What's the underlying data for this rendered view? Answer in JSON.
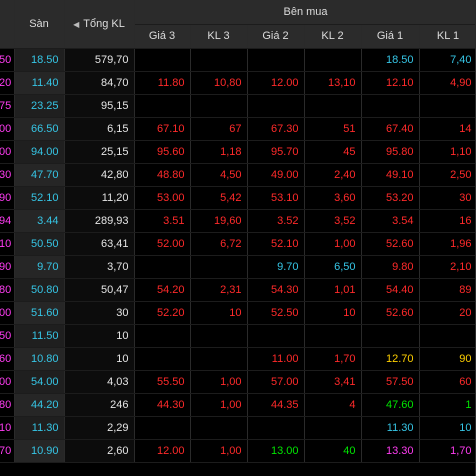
{
  "header": {
    "ref_label": "",
    "floor_label": "Sàn",
    "total_volume_label": "Tổng KL",
    "sort_icon": "triangle-left-icon",
    "buy_side_label": "Bên mua",
    "sub": [
      "Giá 3",
      "KL 3",
      "Giá 2",
      "KL 2",
      "Giá 1",
      "KL 1"
    ]
  },
  "colors": {
    "red": "#ff2a2a",
    "green": "#00e600",
    "cyan": "#36c6e6",
    "yellow": "#ffd000",
    "purple": "#ff3cf2"
  },
  "rows": [
    {
      "ref": "50",
      "floor": "18.50",
      "total": "579,70",
      "p3": "",
      "v3": "",
      "p2": "",
      "v2": "",
      "p1": "18.50",
      "v1": "7,40",
      "c3": "wht",
      "c2": "wht",
      "c1": "cyn"
    },
    {
      "ref": "20",
      "floor": "11.40",
      "total": "84,70",
      "p3": "11.80",
      "v3": "10,80",
      "p2": "12.00",
      "v2": "13,10",
      "p1": "12.10",
      "v1": "4,90",
      "c3": "red",
      "c2": "red",
      "c1": "red"
    },
    {
      "ref": "75",
      "floor": "23.25",
      "total": "95,15",
      "p3": "",
      "v3": "",
      "p2": "",
      "v2": "",
      "p1": "",
      "v1": "",
      "c3": "wht",
      "c2": "wht",
      "c1": "wht"
    },
    {
      "ref": "00",
      "floor": "66.50",
      "total": "6,15",
      "p3": "67.10",
      "v3": "67",
      "p2": "67.30",
      "v2": "51",
      "p1": "67.40",
      "v1": "14",
      "c3": "red",
      "c2": "red",
      "c1": "red"
    },
    {
      "ref": "00",
      "floor": "94.00",
      "total": "25,15",
      "p3": "95.60",
      "v3": "1,18",
      "p2": "95.70",
      "v2": "45",
      "p1": "95.80",
      "v1": "1,10",
      "c3": "red",
      "c2": "red",
      "c1": "red"
    },
    {
      "ref": "30",
      "floor": "47.70",
      "total": "42,80",
      "p3": "48.80",
      "v3": "4,50",
      "p2": "49.00",
      "v2": "2,40",
      "p1": "49.10",
      "v1": "2,50",
      "c3": "red",
      "c2": "red",
      "c1": "red"
    },
    {
      "ref": "90",
      "floor": "52.10",
      "total": "11,20",
      "p3": "53.00",
      "v3": "5,42",
      "p2": "53.10",
      "v2": "3,60",
      "p1": "53.20",
      "v1": "30",
      "c3": "red",
      "c2": "red",
      "c1": "red"
    },
    {
      "ref": "94",
      "floor": "3.44",
      "total": "289,93",
      "p3": "3.51",
      "v3": "19,60",
      "p2": "3.52",
      "v2": "3,52",
      "p1": "3.54",
      "v1": "16",
      "c3": "red",
      "c2": "red",
      "c1": "red"
    },
    {
      "ref": "10",
      "floor": "50.50",
      "total": "63,41",
      "p3": "52.00",
      "v3": "6,72",
      "p2": "52.10",
      "v2": "1,00",
      "p1": "52.60",
      "v1": "1,96",
      "c3": "red",
      "c2": "red",
      "c1": "red"
    },
    {
      "ref": "90",
      "floor": "9.70",
      "total": "3,70",
      "p3": "",
      "v3": "",
      "p2": "9.70",
      "v2": "6,50",
      "p1": "9.80",
      "v1": "2,10",
      "c3": "wht",
      "c2": "cyn",
      "c1": "red"
    },
    {
      "ref": "80",
      "floor": "50.80",
      "total": "50,47",
      "p3": "54.20",
      "v3": "2,31",
      "p2": "54.30",
      "v2": "1,01",
      "p1": "54.40",
      "v1": "89",
      "c3": "red",
      "c2": "red",
      "c1": "red"
    },
    {
      "ref": "00",
      "floor": "51.60",
      "total": "30",
      "p3": "52.20",
      "v3": "10",
      "p2": "52.50",
      "v2": "10",
      "p1": "52.60",
      "v1": "20",
      "c3": "red",
      "c2": "red",
      "c1": "red"
    },
    {
      "ref": "50",
      "floor": "11.50",
      "total": "10",
      "p3": "",
      "v3": "",
      "p2": "",
      "v2": "",
      "p1": "",
      "v1": "",
      "c3": "wht",
      "c2": "wht",
      "c1": "wht"
    },
    {
      "ref": "60",
      "floor": "10.80",
      "total": "10",
      "p3": "",
      "v3": "",
      "p2": "11.00",
      "v2": "1,70",
      "p1": "12.70",
      "v1": "90",
      "c3": "wht",
      "c2": "red",
      "c1": "yel"
    },
    {
      "ref": "00",
      "floor": "54.00",
      "total": "4,03",
      "p3": "55.50",
      "v3": "1,00",
      "p2": "57.00",
      "v2": "3,41",
      "p1": "57.50",
      "v1": "60",
      "c3": "red",
      "c2": "red",
      "c1": "red"
    },
    {
      "ref": "80",
      "floor": "44.20",
      "total": "246",
      "p3": "44.30",
      "v3": "1,00",
      "p2": "44.35",
      "v2": "4",
      "p1": "47.60",
      "v1": "1",
      "c3": "red",
      "c2": "red",
      "c1": "grn"
    },
    {
      "ref": "10",
      "floor": "11.30",
      "total": "2,29",
      "p3": "",
      "v3": "",
      "p2": "",
      "v2": "",
      "p1": "11.30",
      "v1": "10",
      "c3": "wht",
      "c2": "wht",
      "c1": "cyn"
    },
    {
      "ref": "70",
      "floor": "10.90",
      "total": "2,60",
      "p3": "12.00",
      "v3": "1,00",
      "p2": "13.00",
      "v2": "40",
      "p1": "13.30",
      "v1": "1,70",
      "c3": "red",
      "c2": "grn",
      "c1": "pur"
    }
  ]
}
